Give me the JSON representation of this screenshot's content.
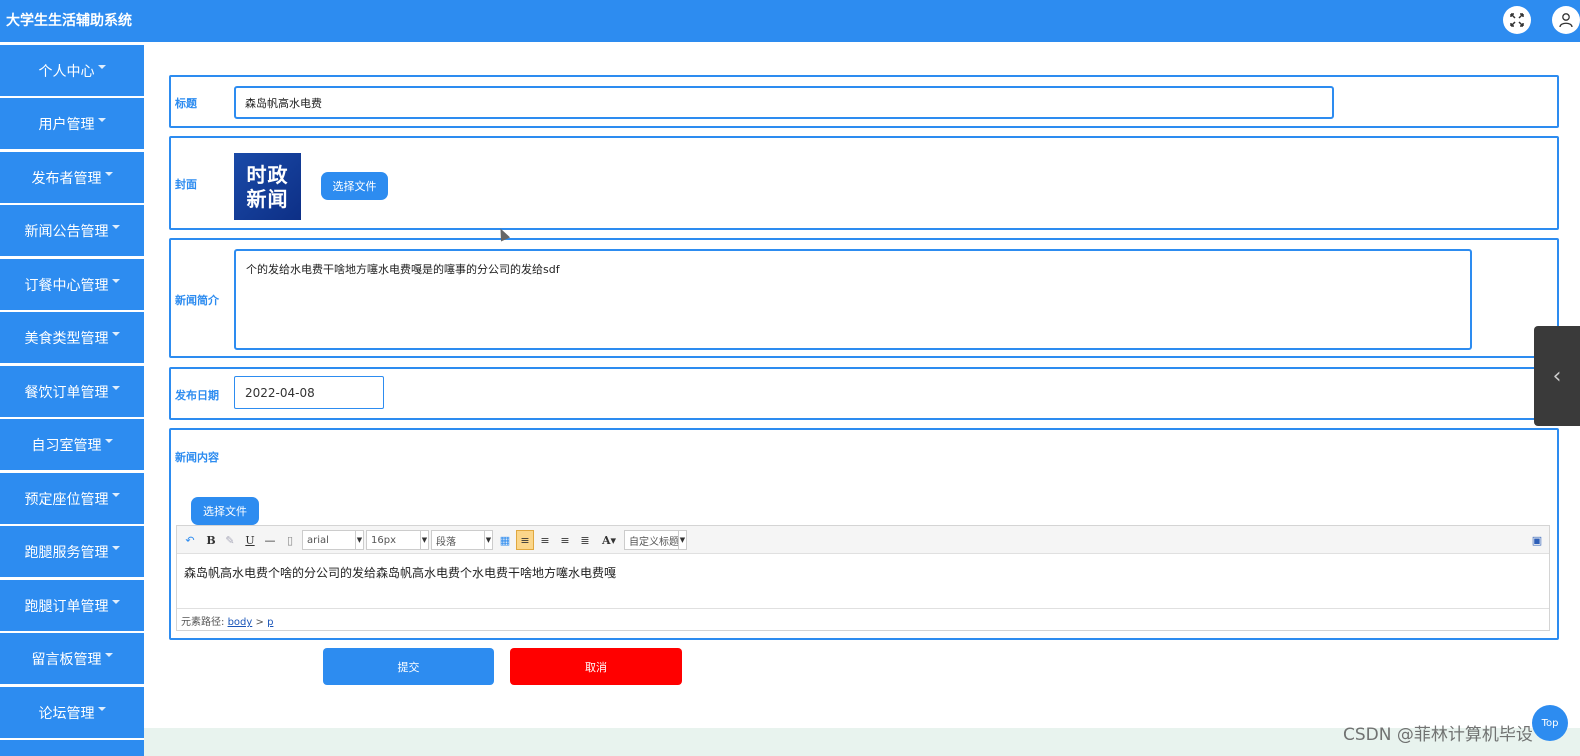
{
  "app": {
    "title": "大学生生活辅助系统"
  },
  "header": {
    "icons": [
      "expand-icon",
      "user-icon"
    ]
  },
  "sidebar": {
    "items": [
      {
        "label": "个人中心"
      },
      {
        "label": "用户管理"
      },
      {
        "label": "发布者管理"
      },
      {
        "label": "新闻公告管理"
      },
      {
        "label": "订餐中心管理"
      },
      {
        "label": "美食类型管理"
      },
      {
        "label": "餐饮订单管理"
      },
      {
        "label": "自习室管理"
      },
      {
        "label": "预定座位管理"
      },
      {
        "label": "跑腿服务管理"
      },
      {
        "label": "跑腿订单管理"
      },
      {
        "label": "留言板管理"
      },
      {
        "label": "论坛管理"
      }
    ]
  },
  "form": {
    "title": {
      "label": "标题",
      "value": "森岛帆高水电费"
    },
    "cover": {
      "label": "封面",
      "image_text_line1": "时政",
      "image_text_line2": "新闻",
      "button": "选择文件"
    },
    "summary": {
      "label": "新闻简介",
      "value": "个的发给水电费干啥地方噻水电费嘎是的噻事的分公司的发给sdf"
    },
    "date": {
      "label": "发布日期",
      "value": "2022-04-08"
    },
    "content": {
      "label": "新闻内容",
      "button": "选择文件",
      "toolbar": {
        "font": "arial",
        "size": "16px",
        "paragraph": "段落",
        "custom_title": "自定义标题"
      },
      "body": "森岛帆高水电费个啥的分公司的发给森岛帆高水电费个水电费干啥地方噻水电费嘎",
      "path_label": "元素路径:",
      "path_body": "body",
      "path_sep": ">",
      "path_p": "p"
    }
  },
  "actions": {
    "submit": "提交",
    "cancel": "取消"
  },
  "misc": {
    "top_button": "Top",
    "watermark": "CSDN @菲林计算机毕设"
  },
  "colors": {
    "primary": "#2d8cf0",
    "danger": "#ff0000",
    "bottom_strip": "#e8f3ee"
  }
}
